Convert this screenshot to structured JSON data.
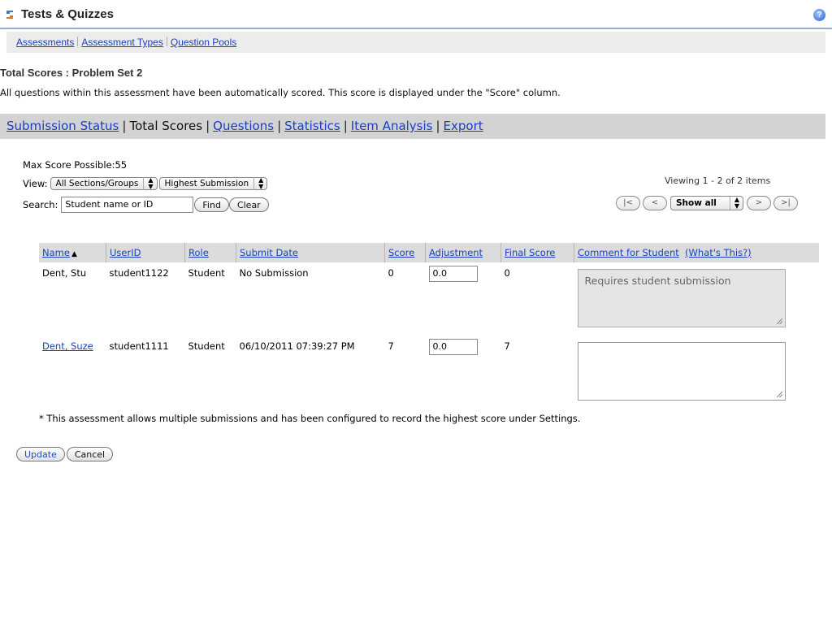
{
  "app": {
    "title": "Tests & Quizzes",
    "icon": "tools-icon",
    "help_icon": "help-icon"
  },
  "toolbar": {
    "items": [
      "Assessments",
      "Assessment Types",
      "Question Pools"
    ]
  },
  "page": {
    "heading": "Total Scores : Problem Set 2",
    "info": "All questions within this assessment have been automatically scored. This score is displayed under the \"Score\" column."
  },
  "tabs": {
    "submission_status": "Submission Status",
    "total_scores": "Total Scores",
    "questions": "Questions",
    "statistics": "Statistics",
    "item_analysis": "Item Analysis",
    "export": "Export",
    "separator": "|"
  },
  "filters": {
    "max_score": "Max Score Possible:55",
    "view_label": "View:",
    "view_sections": "All Sections/Groups",
    "view_submission": "Highest Submission",
    "search_label": "Search:",
    "search_value": "Student name or ID",
    "find": "Find",
    "clear": "Clear"
  },
  "pager": {
    "viewing": "Viewing 1 - 2 of 2 items",
    "first": "|<",
    "prev": "<",
    "page_size": "Show all",
    "next": ">",
    "last": ">|"
  },
  "table": {
    "headers": {
      "name": "Name",
      "sort_indicator": "▲",
      "userid": "UserID",
      "role": "Role",
      "submit_date": "Submit Date",
      "score": "Score",
      "adjustment": "Adjustment",
      "final_score": "Final Score",
      "comment": "Comment for Student",
      "whats_this": "(What's This?)"
    },
    "rows": [
      {
        "name": "Dent, Stu",
        "userid": "student1122",
        "role": "Student",
        "submit_date": "No Submission",
        "score": "0",
        "adjustment": "0.0",
        "final_score": "0",
        "comment": "Requires student submission"
      },
      {
        "name": "Dent, Suze",
        "userid": "student1111",
        "role": "Student",
        "submit_date": "06/10/2011 07:39:27 PM",
        "score": "7",
        "adjustment": "0.0",
        "final_score": "7",
        "comment": ""
      }
    ]
  },
  "footnote": "* This assessment allows multiple submissions and has been configured to record the highest score under Settings.",
  "actions": {
    "update": "Update",
    "cancel": "Cancel"
  }
}
